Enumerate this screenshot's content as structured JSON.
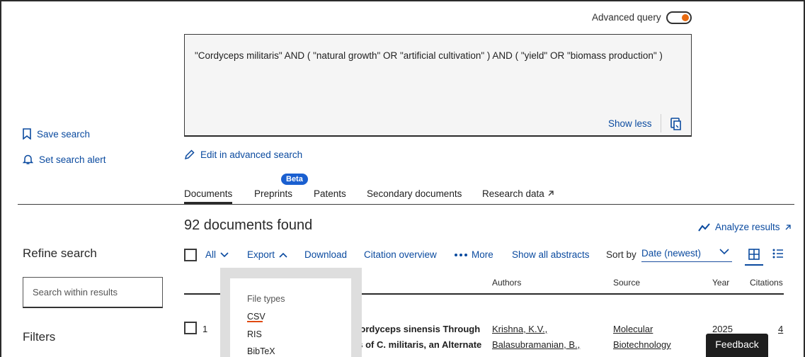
{
  "advanced_query": {
    "label": "Advanced query",
    "enabled": true
  },
  "query": {
    "text": "\"Cordyceps militaris\" AND ( \"natural growth\" OR \"artificial cultivation\" ) AND ( \"yield\" OR \"biomass production\" )",
    "show_less": "Show less",
    "copy_icon": "copy-icon"
  },
  "left": {
    "save_search": "Save search",
    "set_alert": "Set search alert",
    "refine": "Refine search",
    "search_within_placeholder": "Search within results",
    "filters": "Filters"
  },
  "edit_advanced": "Edit in advanced search",
  "tabs": [
    {
      "label": "Documents",
      "active": true
    },
    {
      "label": "Preprints",
      "badge": "Beta"
    },
    {
      "label": "Patents"
    },
    {
      "label": "Secondary documents"
    },
    {
      "label": "Research data",
      "icon": "external-arrow-icon"
    }
  ],
  "results": {
    "count_text": "92 documents found",
    "analyze": "Analyze results"
  },
  "toolbar": {
    "all": "All",
    "export": "Export",
    "download": "Download",
    "citation_overview": "Citation overview",
    "more": "More",
    "show_abstracts": "Show all abstracts",
    "sort_by_label": "Sort by",
    "sort_value": "Date (newest)"
  },
  "table": {
    "headers": [
      "Authors",
      "Source",
      "Year",
      "Citations"
    ],
    "rows": [
      {
        "num": "1",
        "title_line1": "Cordyceps sinensis Through",
        "title_line2": "es of C. militaris, an Alternate",
        "authors": [
          "Krishna, K.V.,",
          "Balasubramanian, B.,"
        ],
        "source": [
          "Molecular",
          "Biotechnology"
        ],
        "year": "2025",
        "citations": "4"
      }
    ]
  },
  "export_menu": {
    "heading": "File types",
    "items": [
      "CSV",
      "RIS",
      "BibTeX"
    ]
  },
  "feedback": "Feedback",
  "colors": {
    "accent": "#0a4a9f",
    "toggle": "#e86a10",
    "beta": "#1a5fd0"
  }
}
